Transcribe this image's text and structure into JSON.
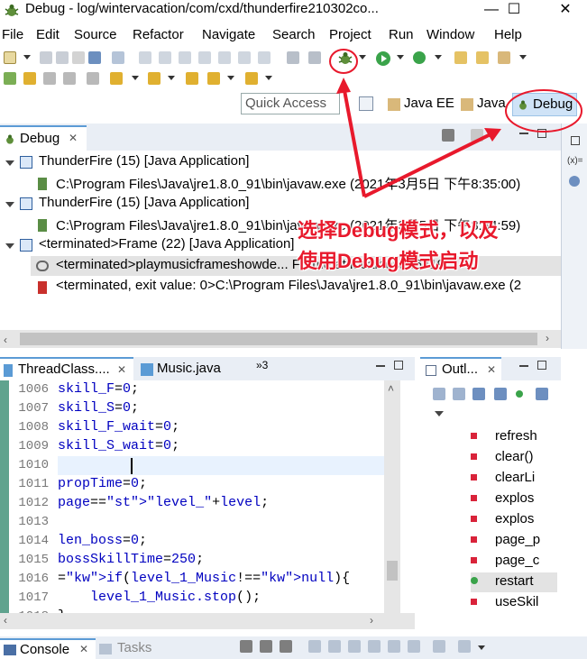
{
  "window": {
    "title": "Debug - log/wintervacation/com/cxd/thunderfire210302co...",
    "minimize": "—",
    "maximize": "☐",
    "close": "✕"
  },
  "menu": [
    "File",
    "Edit",
    "Source",
    "Refactor",
    "Navigate",
    "Search",
    "Project",
    "Run",
    "Window",
    "Help"
  ],
  "quick_access": {
    "placeholder": "Quick Access"
  },
  "perspectives": [
    {
      "label": "Java EE",
      "icon": "java-ee-perspective-icon"
    },
    {
      "label": "Java",
      "icon": "java-perspective-icon"
    },
    {
      "label": "Debug",
      "icon": "debug-bug-icon",
      "active": true
    }
  ],
  "debug_view": {
    "tab": "Debug",
    "close": "✕",
    "tree": [
      {
        "label": "ThunderFire (15) [Java Application]",
        "level": 0,
        "icon": "java-app-icon"
      },
      {
        "label": "C:\\Program Files\\Java\\jre1.8.0_91\\bin\\javaw.exe (2021年3月5日 下午8:35:00)",
        "level": 1,
        "icon": "process-icon"
      },
      {
        "label": "ThunderFire (15) [Java Application]",
        "level": 0,
        "icon": "java-app-icon"
      },
      {
        "label": "C:\\Program Files\\Java\\jre1.8.0_91\\bin\\javaw.exe (2021年3月5日 下午8:34:59)",
        "level": 1,
        "icon": "process-icon"
      },
      {
        "label": "<terminated>Frame (22) [Java Application]",
        "level": 0,
        "icon": "java-app-icon"
      },
      {
        "label": "<terminated>playmusicframeshowde... Frame at localhost:56419",
        "level": 1,
        "icon": "thread-icon",
        "selected": true
      },
      {
        "label": "<terminated, exit value: 0>C:\\Program Files\\Java\\jre1.8.0_91\\bin\\javaw.exe (2",
        "level": 1,
        "icon": "terminated-process-icon"
      }
    ]
  },
  "annotation": {
    "line1": "选择Debug模式，以及",
    "line2": "使用Debug模式启动",
    "color": "#e8192c"
  },
  "editor": {
    "tabs": [
      {
        "label": "ThreadClass....",
        "close": "✕",
        "active": true
      },
      {
        "label": "Music.java",
        "active": false
      }
    ],
    "overflow": "»3",
    "lines": [
      {
        "n": "1006",
        "code": "skill_F=0;"
      },
      {
        "n": "1007",
        "code": "skill_S=0;"
      },
      {
        "n": "1008",
        "code": "skill_F_wait=0;"
      },
      {
        "n": "1009",
        "code": "skill_S_wait=0;"
      },
      {
        "n": "1010",
        "code": ""
      },
      {
        "n": "1011",
        "code": "propTime=0;"
      },
      {
        "n": "1012",
        "code": "page=\"level_\"+level;"
      },
      {
        "n": "1013",
        "code": ""
      },
      {
        "n": "1014",
        "code": "len_boss=0;"
      },
      {
        "n": "1015",
        "code": "bossSkillTime=250;"
      },
      {
        "n": "1016",
        "code": "if(level_1_Music!=null){"
      },
      {
        "n": "1017",
        "code": "    level_1_Music.stop();"
      },
      {
        "n": "1018",
        "code": "}"
      }
    ]
  },
  "outline": {
    "tab": "Outl...",
    "close": "✕",
    "items": [
      {
        "label": "refresh",
        "marker": "private"
      },
      {
        "label": "clear()",
        "marker": "private"
      },
      {
        "label": "clearLi",
        "marker": "private"
      },
      {
        "label": "explos",
        "marker": "private"
      },
      {
        "label": "explos",
        "marker": "private"
      },
      {
        "label": "page_p",
        "marker": "private"
      },
      {
        "label": "page_c",
        "marker": "private"
      },
      {
        "label": "restart",
        "marker": "public",
        "selected": true
      },
      {
        "label": "useSkil",
        "marker": "private"
      }
    ]
  },
  "bottom": {
    "console": "Console",
    "close": "✕",
    "tasks": "Tasks"
  },
  "variables_side": {
    "label": "(x)="
  }
}
